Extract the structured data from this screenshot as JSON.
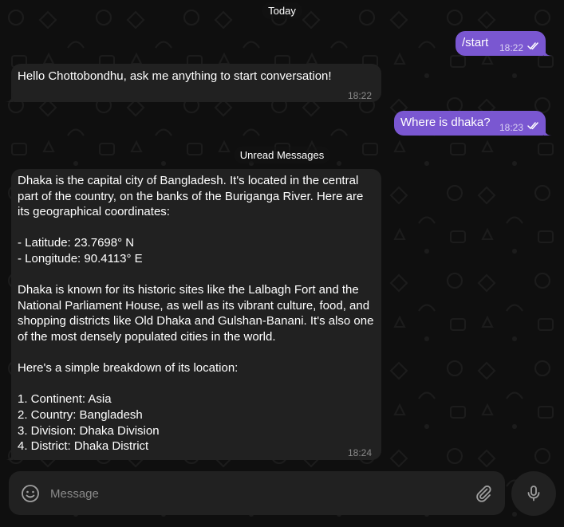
{
  "chat": {
    "date_label": "Today",
    "unread_label": "Unread Messages",
    "messages": [
      {
        "direction": "out",
        "text": "/start",
        "time": "18:22",
        "status": "read"
      },
      {
        "direction": "in",
        "text": "Hello Chottobondhu, ask me anything to start conversation!",
        "time": "18:22"
      },
      {
        "direction": "out",
        "text": "Where is dhaka?",
        "time": "18:23",
        "status": "read"
      },
      {
        "direction": "in",
        "time": "18:24",
        "lines": [
          "Dhaka is the capital city of Bangladesh. It's located in the central part of the country, on the banks of the Buriganga River. Here are its geographical coordinates:",
          "",
          "- Latitude: 23.7698° N",
          "- Longitude: 90.4113° E",
          "",
          "Dhaka is known for its historic sites like the Lalbagh Fort and the National Parliament House, as well as its vibrant culture, food, and shopping districts like Old Dhaka and Gulshan-Banani. It's also one of the most densely populated cities in the world.",
          "",
          "Here's a simple breakdown of its location:",
          "",
          "1. Continent: Asia",
          "2. Country: Bangladesh",
          "3. Division: Dhaka Division",
          "4. District: Dhaka District"
        ]
      }
    ]
  },
  "composer": {
    "placeholder": "Message",
    "value": ""
  },
  "icons": {
    "emoji": "smiley-icon",
    "attach": "paperclip-icon",
    "mic": "microphone-icon",
    "read": "double-check-icon"
  },
  "colors": {
    "background": "#0f0f0f",
    "incoming_bubble": "#212121",
    "outgoing_bubble": "#7a57d1",
    "muted_text": "#8a8a8a"
  }
}
